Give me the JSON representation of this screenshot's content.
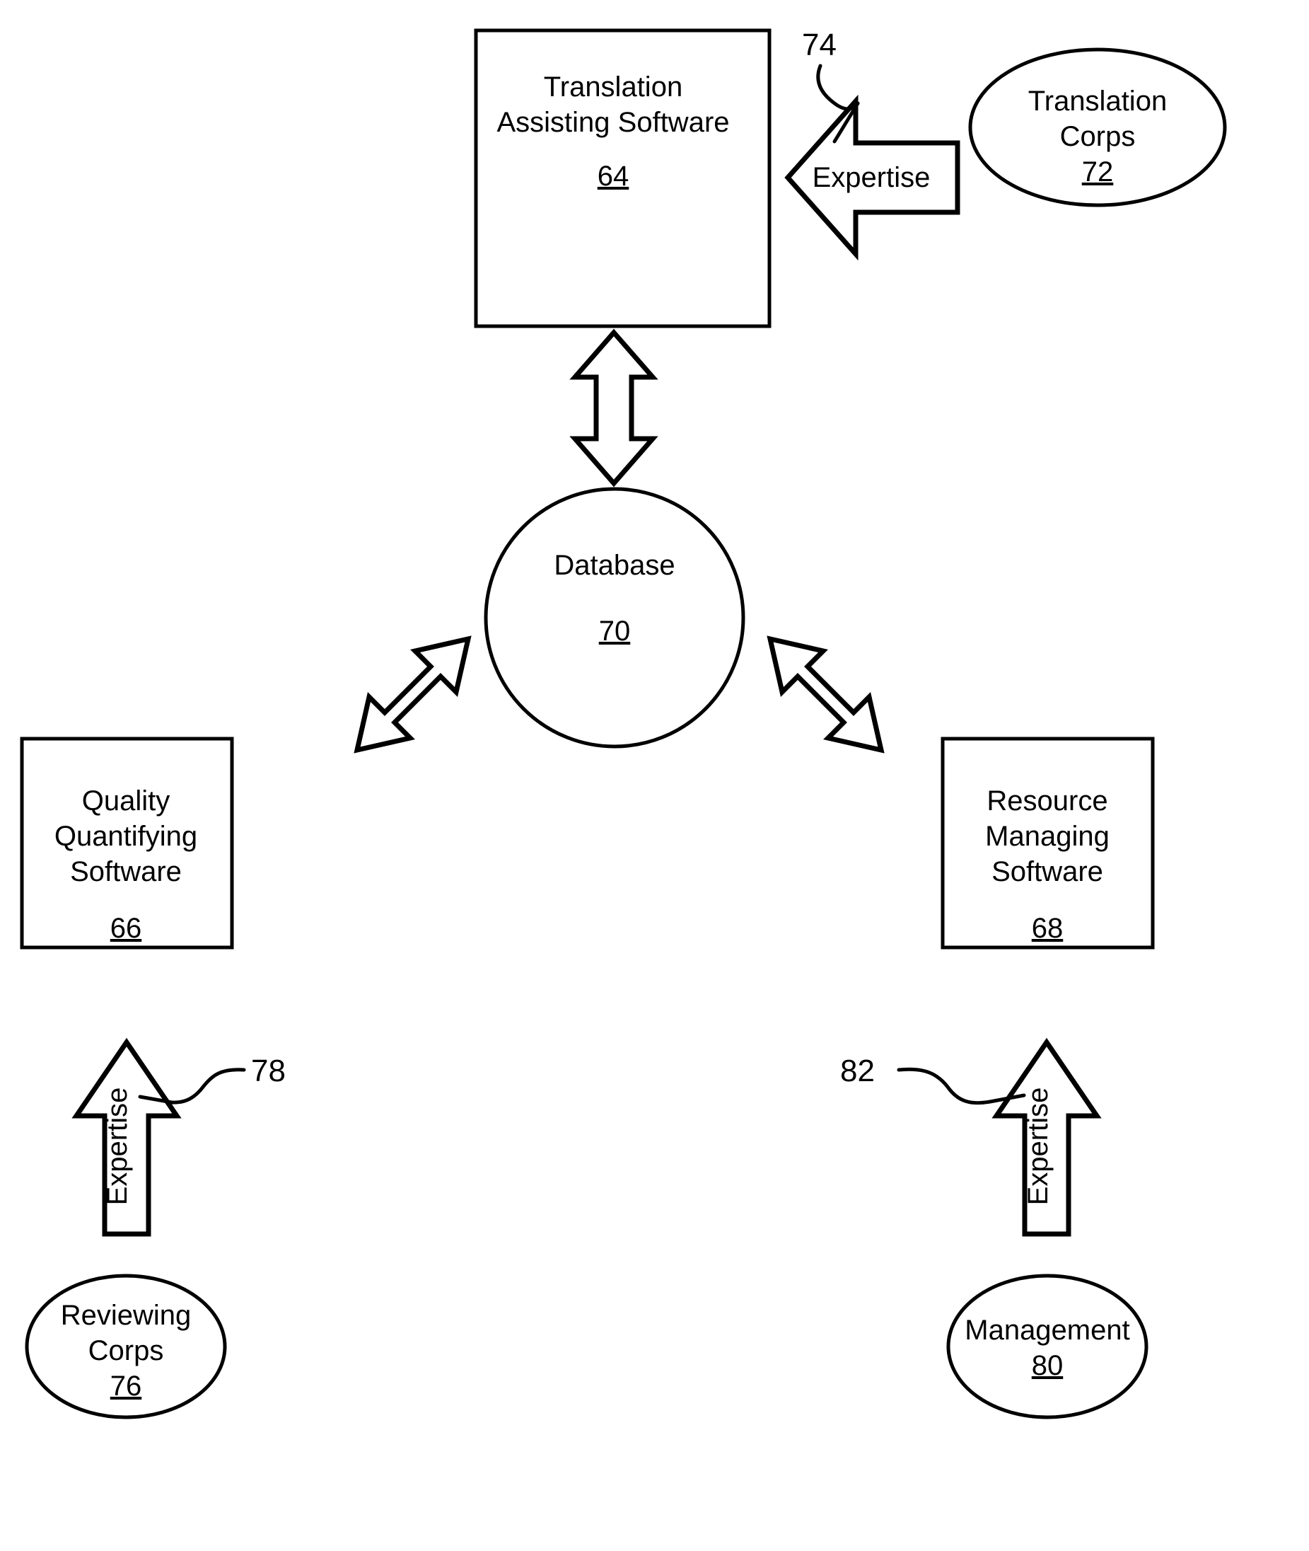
{
  "figure": {
    "title": "Translation workflow system block diagram",
    "background_color": "#ffffff",
    "line_color": "#000000"
  },
  "nodes": {
    "translation_assisting_software": {
      "shape": "rectangle",
      "line1": "Translation",
      "line2": "Assisting Software",
      "ref": "64"
    },
    "quality_quantifying_software": {
      "shape": "rectangle",
      "line1": "Quality",
      "line2": "Quantifying",
      "line3": "Software",
      "ref": "66"
    },
    "resource_managing_software": {
      "shape": "rectangle",
      "line1": "Resource",
      "line2": "Managing",
      "line3": "Software",
      "ref": "68"
    },
    "database": {
      "shape": "circle",
      "line1": "Database",
      "ref": "70"
    },
    "translation_corps": {
      "shape": "ellipse",
      "line1": "Translation",
      "line2": "Corps",
      "ref": "72"
    },
    "reviewing_corps": {
      "shape": "ellipse",
      "line1": "Reviewing",
      "line2": "Corps",
      "ref": "76"
    },
    "management": {
      "shape": "ellipse",
      "line1": "Management",
      "ref": "80"
    }
  },
  "connectors": {
    "expertise_to_translation": {
      "label": "Expertise",
      "ref": "74",
      "direction": "left",
      "from": "translation_corps",
      "to": "translation_assisting_software"
    },
    "expertise_to_quality": {
      "label": "Expertise",
      "ref": "78",
      "direction": "up",
      "from": "reviewing_corps",
      "to": "quality_quantifying_software"
    },
    "expertise_to_resource": {
      "label": "Expertise",
      "ref": "82",
      "direction": "up",
      "from": "management",
      "to": "resource_managing_software"
    },
    "db_translation": {
      "label": "",
      "direction": "bidirectional-vertical",
      "from": "translation_assisting_software",
      "to": "database"
    },
    "db_quality": {
      "label": "",
      "direction": "bidirectional-diagonal",
      "from": "database",
      "to": "quality_quantifying_software"
    },
    "db_resource": {
      "label": "",
      "direction": "bidirectional-diagonal",
      "from": "database",
      "to": "resource_managing_software"
    }
  }
}
